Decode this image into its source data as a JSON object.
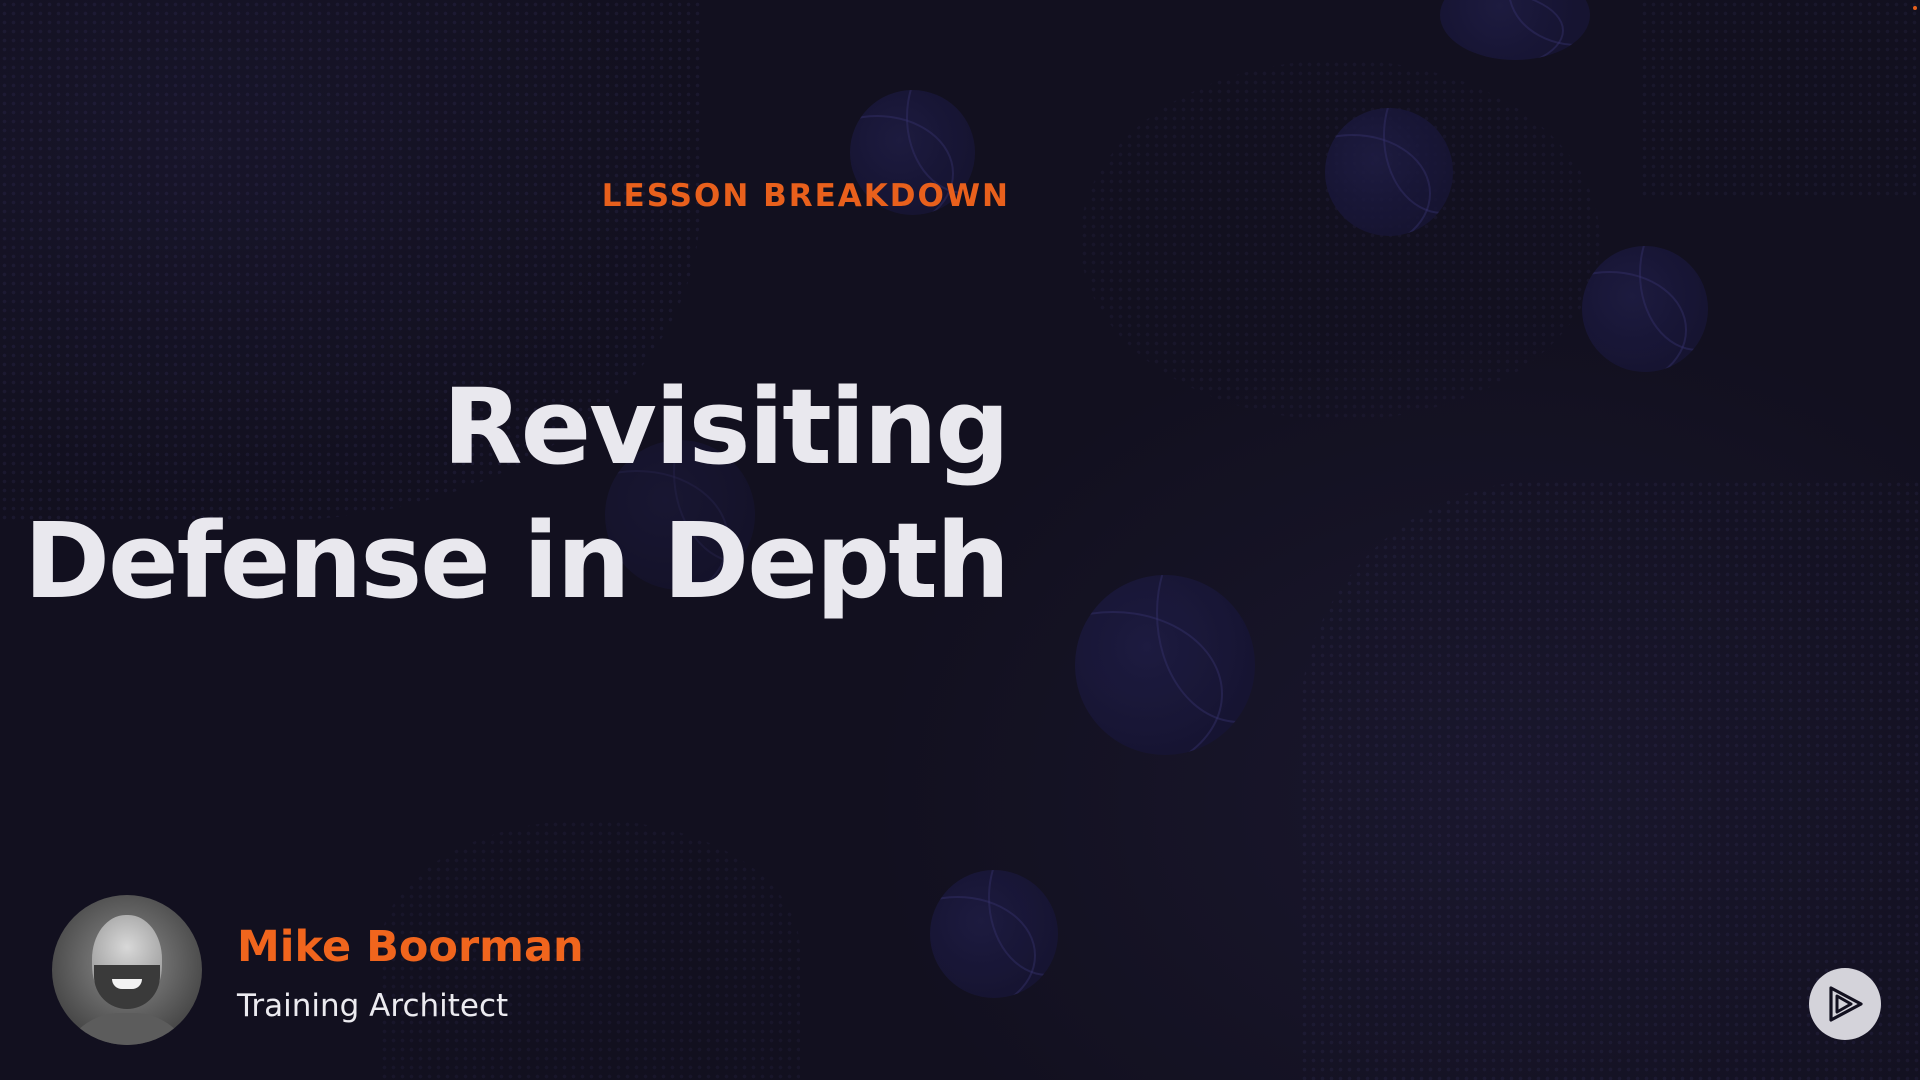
{
  "slide": {
    "eyebrow": "LESSON BREAKDOWN",
    "title_lines": [
      "Revisiting",
      "Defense in Depth"
    ]
  },
  "presenter": {
    "name": "Mike Boorman",
    "role": "Training Architect"
  },
  "colors": {
    "background": "#12101f",
    "accent": "#e8601c",
    "title": "#e9e8ee"
  },
  "icons": {
    "logo": "play-logo-icon",
    "avatar": "presenter-avatar"
  }
}
